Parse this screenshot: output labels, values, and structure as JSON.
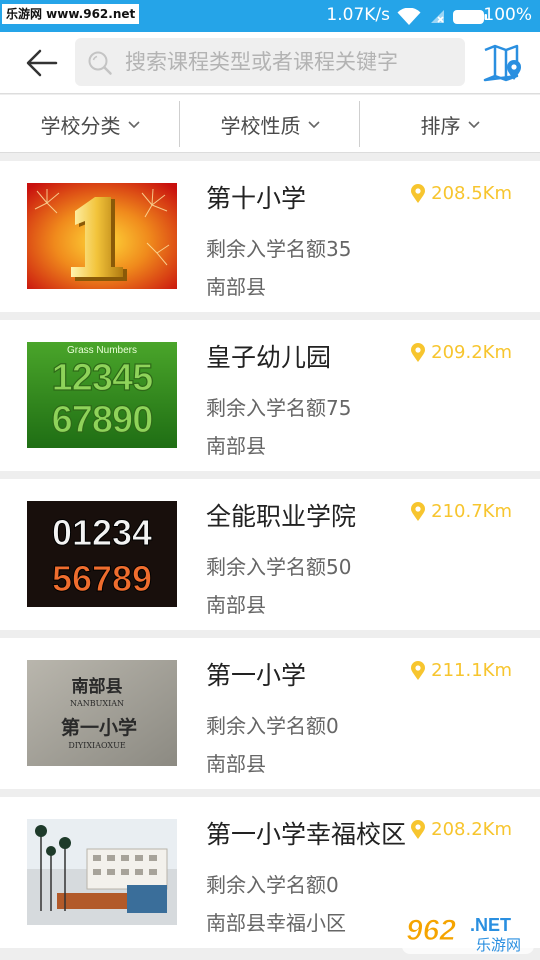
{
  "status_bar": {
    "watermark_text": "乐游网 www.962.net",
    "network_speed": "1.07K/s",
    "battery_percent": "100%",
    "icons": [
      "wifi-icon",
      "no-sim-icon",
      "battery-icon"
    ]
  },
  "header": {
    "back_icon": "back-arrow-icon",
    "search_placeholder": "搜索课程类型或者课程关键字",
    "map_icon": "map-pin-icon"
  },
  "filters": [
    {
      "label": "学校分类"
    },
    {
      "label": "学校性质"
    },
    {
      "label": "排序"
    }
  ],
  "schools": [
    {
      "name": "第十小学",
      "quota": "剩余入学名额35",
      "area": "南部县",
      "distance": "208.5Km",
      "image": "fireworks-number-one"
    },
    {
      "name": "皇子幼儿园",
      "quota": "剩余入学名额75",
      "area": "南部县",
      "distance": "209.2Km",
      "image": "grass-numbers"
    },
    {
      "name": "全能职业学院",
      "quota": "剩余入学名额50",
      "area": "南部县",
      "distance": "210.7Km",
      "image": "colorful-numbers"
    },
    {
      "name": "第一小学",
      "quota": "剩余入学名额0",
      "area": "南部县",
      "distance": "211.1Km",
      "image": "stone-school-sign"
    },
    {
      "name": "第一小学幸福校区",
      "quota": "剩余入学名额0",
      "area": "南部县幸福小区",
      "distance": "208.2Km",
      "image": "school-building"
    }
  ],
  "images": {
    "grass_title": "Grass Numbers",
    "grass_row1": "12345",
    "grass_row2": "67890",
    "color_row1": "01234",
    "color_row2": "56789",
    "stone_line1": "南部县",
    "stone_line2": "NANBUXIAN",
    "stone_line3": "第一小学",
    "stone_line4": "DIYIXIAOXUE",
    "big_digit": "1"
  },
  "brand_watermark": {
    "number": "962",
    "domain": ".NET",
    "name": "乐游网"
  },
  "colors": {
    "status_bar": "#25a4e8",
    "accent": "#f7c52e",
    "header_bg": "#ffffff",
    "page_bg": "#eeeeee"
  }
}
